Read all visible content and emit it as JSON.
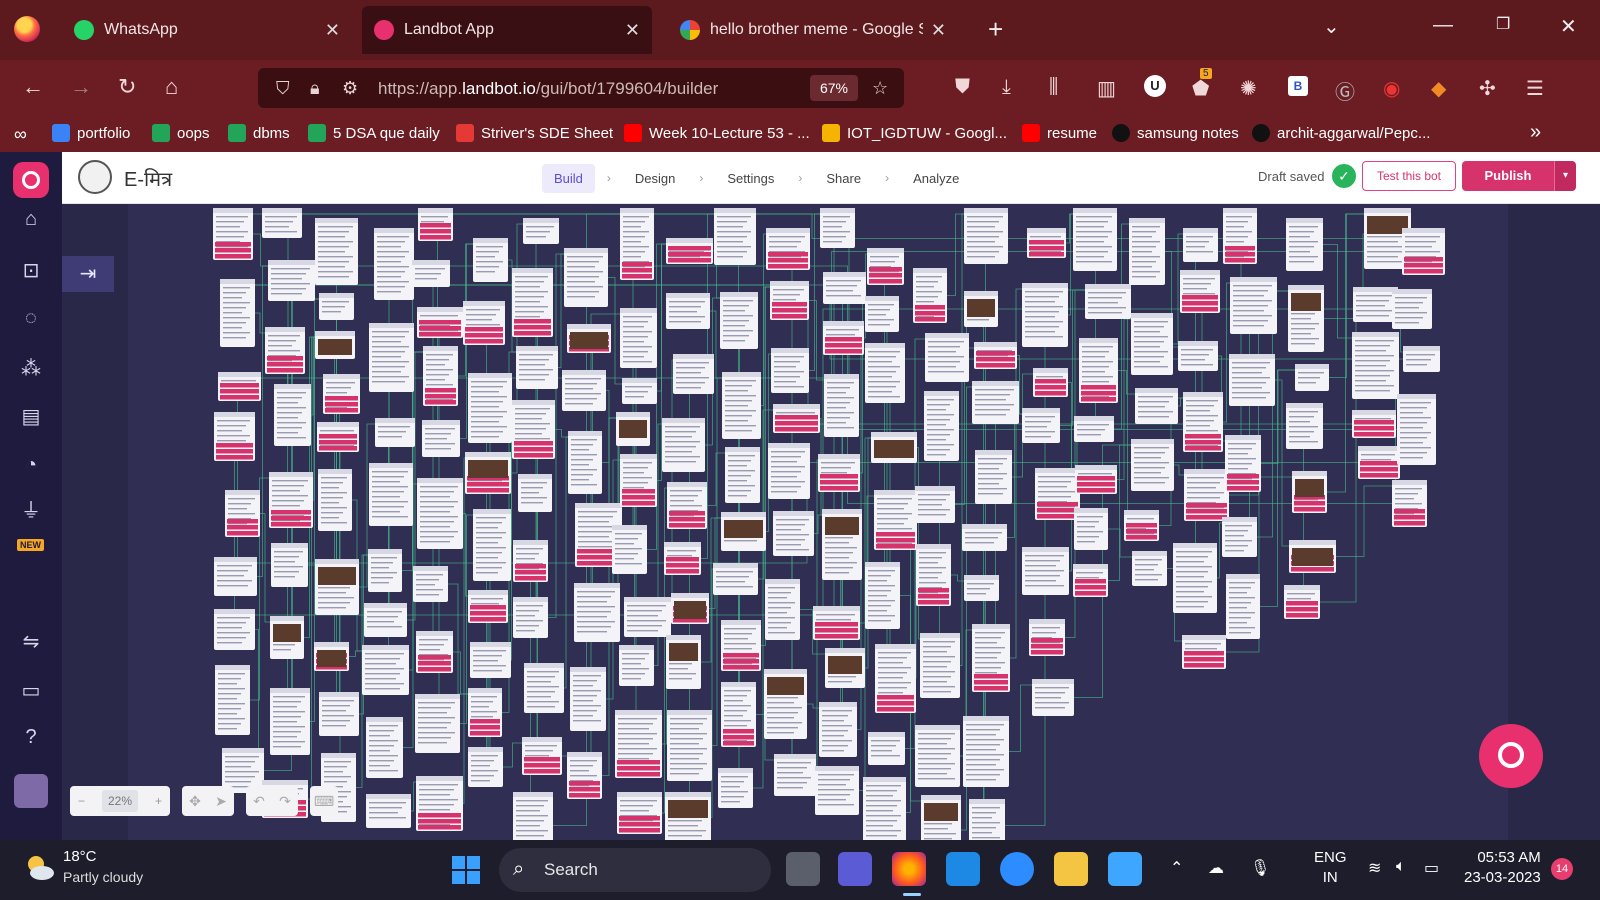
{
  "browser": {
    "tabs": [
      {
        "title": "WhatsApp",
        "active": false
      },
      {
        "title": "Landbot App",
        "active": true
      },
      {
        "title": "hello brother meme - Google Sear",
        "active": false
      }
    ],
    "url_prefix": "https://app.",
    "url_domain": "landbot.io",
    "url_path": "/gui/bot/1799604/builder",
    "zoom": "67%",
    "extension_badge": "5",
    "bookmarks": [
      {
        "label": "portfolio",
        "icon": "link-icon",
        "color": "#3b82f6"
      },
      {
        "label": "oops",
        "icon": "sheets-icon",
        "color": "#22a559"
      },
      {
        "label": "dbms",
        "icon": "sheets-icon",
        "color": "#22a559"
      },
      {
        "label": "5 DSA que daily",
        "icon": "sheets-icon",
        "color": "#22a559"
      },
      {
        "label": "Striver's SDE Sheet",
        "icon": "tuf-icon",
        "color": "#e53935"
      },
      {
        "label": "Week 10-Lecture 53 - ...",
        "icon": "youtube-icon",
        "color": "#ff0000"
      },
      {
        "label": "IOT_IGDTUW - Googl...",
        "icon": "drive-icon",
        "color": "#f4b400"
      },
      {
        "label": "resume",
        "icon": "youtube-icon",
        "color": "#ff0000"
      },
      {
        "label": "samsung notes",
        "icon": "github-icon",
        "color": "#111111"
      },
      {
        "label": "archit-aggarwal/Pepc...",
        "icon": "github-icon",
        "color": "#111111"
      }
    ]
  },
  "app": {
    "bot_name": "E-मित्र",
    "steps": [
      "Build",
      "Design",
      "Settings",
      "Share",
      "Analyze"
    ],
    "active_step": "Build",
    "draft_status": "Draft saved",
    "test_label": "Test this bot",
    "publish_label": "Publish",
    "zoom_level": "22%",
    "sidebar_new_badge": "NEW",
    "accent_color": "#d6336c",
    "brand_color": "#e9306e"
  },
  "taskbar": {
    "temperature": "18°C",
    "weather": "Partly cloudy",
    "search_label": "Search",
    "language": "ENG",
    "region": "IN",
    "time": "05:53 AM",
    "date": "23-03-2023",
    "notifications": "14"
  }
}
